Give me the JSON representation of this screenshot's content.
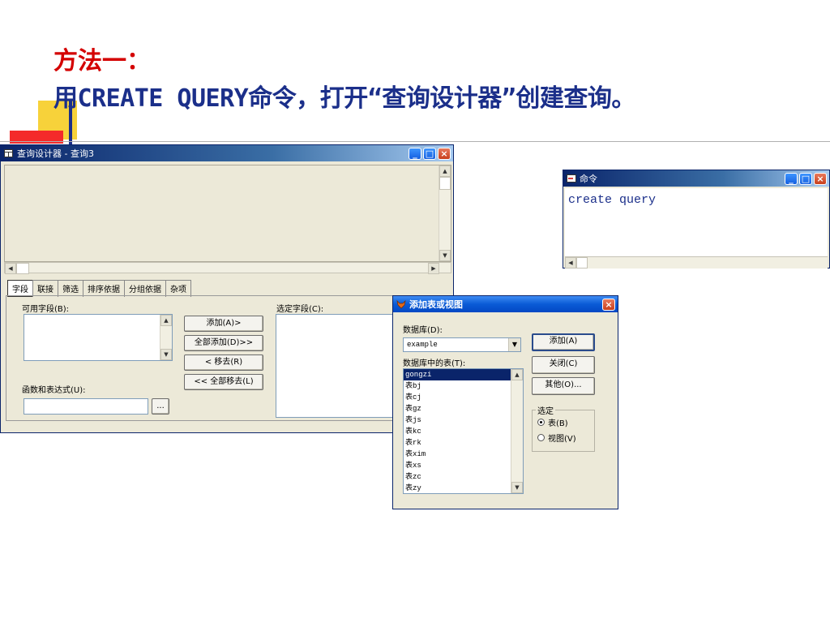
{
  "slide": {
    "heading": "方法一：",
    "subheading": "用CREATE QUERY命令，打开“查询设计器”创建查询。"
  },
  "query_designer": {
    "title": "查询设计器 - 查询3",
    "tabs": [
      "字段",
      "联接",
      "筛选",
      "排序依据",
      "分组依据",
      "杂项"
    ],
    "available_fields_label": "可用字段(B):",
    "selected_fields_label": "选定字段(C):",
    "expression_label": "函数和表达式(U):",
    "expression_button": "...",
    "buttons": {
      "add": "添加(A)>",
      "add_all": "全部添加(D)>>",
      "remove": "< 移去(R)",
      "remove_all": "<< 全部移去(L)"
    },
    "controls": {
      "minimize": "_",
      "maximize": "□",
      "close": "×"
    }
  },
  "command_window": {
    "title": "命令",
    "command_text": "create query",
    "controls": {
      "minimize": "_",
      "maximize": "□",
      "close": "×"
    }
  },
  "add_table_dialog": {
    "title": "添加表或视图",
    "database_label": "数据库(D):",
    "database_value": "example",
    "tables_label": "数据库中的表(T):",
    "tables": [
      "gongzi",
      "表bj",
      "表cj",
      "表gz",
      "表js",
      "表kc",
      "表rk",
      "表xim",
      "表xs",
      "表zc",
      "表zy"
    ],
    "selected_table_index": 0,
    "buttons": {
      "add": "添加(A)",
      "close": "关闭(C)",
      "other": "其他(O)..."
    },
    "group_label": "选定",
    "radio_table": "表(B)",
    "radio_view": "视图(V)",
    "selected_radio": "table",
    "close_control": "×"
  },
  "icons": {
    "query_designer_icon": "table-grid-icon",
    "command_icon": "command-window-icon",
    "dialog_icon": "foxpro-fox-icon"
  },
  "colors": {
    "heading": "#d40000",
    "subheading": "#1b2f8a",
    "title_bar": "#0a5bd6",
    "selection": "#0a246a"
  }
}
